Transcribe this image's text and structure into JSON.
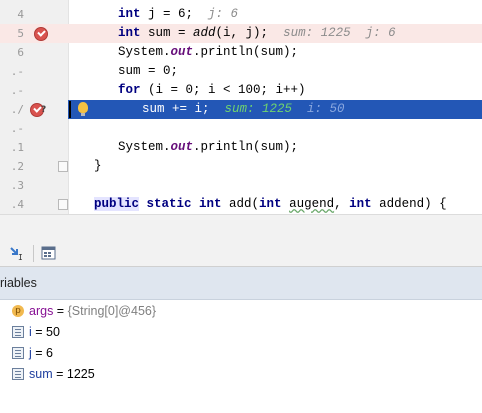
{
  "editor": {
    "lines": [
      {
        "num": "4"
      },
      {
        "num": "5"
      },
      {
        "num": "6"
      },
      {
        "num": ".-"
      },
      {
        "num": ".-"
      },
      {
        "num": ".-"
      },
      {
        "num": "./"
      },
      {
        "num": ".-"
      },
      {
        "num": ".0"
      },
      {
        "num": ".1"
      },
      {
        "num": ".2"
      },
      {
        "num": ".3"
      },
      {
        "num": ".4"
      }
    ],
    "code": {
      "l4_kw": "int",
      "l4_text": " j = 6;",
      "l4_hint": "  j: 6",
      "l5_kw": "int",
      "l5_text1": " sum = ",
      "l5_method": "add",
      "l5_text2": "(i, j);",
      "l5_hint": "  sum: 1225  j: 6",
      "l6_a": "System.",
      "l6_b": "out",
      "l6_c": ".println(sum);",
      "l7_text": "sum = 0;",
      "l8_kw": "for",
      "l8_text": " (i = 0; i < 100; i++)",
      "l9_text": "sum += i;",
      "l9_hint1": "  sum: 1225",
      "l9_hint2": "  i: 50",
      "l11_a": "System.",
      "l11_b": "out",
      "l11_c": ".println(sum);",
      "l12_text": "}",
      "l14_kw1": "public",
      "l14_kw2": " static int",
      "l14_t1": " add(",
      "l14_kw3": "int",
      "l14_t2": " ",
      "l14_p1": "augend",
      "l14_t3": ", ",
      "l14_kw4": "int",
      "l14_t4": " addend) {"
    }
  },
  "variables": {
    "header": "riables",
    "items": [
      {
        "icon": "p",
        "name": "args",
        "eq": " = ",
        "value": "{String[0]@456}"
      },
      {
        "name": "i",
        "eq": " = ",
        "value": "50"
      },
      {
        "name": "j",
        "eq": " = ",
        "value": "6"
      },
      {
        "name": "sum",
        "eq": " = ",
        "value": "1225"
      }
    ]
  },
  "colors": {
    "current_line": "#2357b6",
    "breakpoint_line": "#fae8e6",
    "breakpoint": "#d9534f"
  }
}
